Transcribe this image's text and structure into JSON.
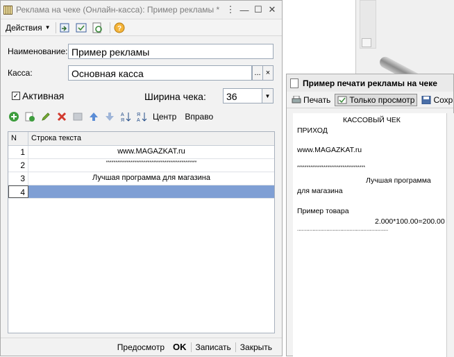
{
  "main_window": {
    "title": "Реклама на чеке (Онлайн-касса): Пример рекламы *",
    "toolbar": {
      "actions_label": "Действия"
    },
    "form": {
      "name_label": "Наименование:",
      "name_value": "Пример рекламы",
      "kassa_label": "Касса:",
      "kassa_value": "Основная касса",
      "kassa_select_btn": "...",
      "kassa_clear_btn": "×",
      "active_label": "Активная",
      "active_checked": true,
      "width_label": "Ширина чека:",
      "width_value": "36"
    },
    "cmdbar": {
      "center_label": "Центр",
      "right_label": "Вправо"
    },
    "grid": {
      "col_n": "N",
      "col_text": "Строка текста",
      "rows": [
        {
          "n": "1",
          "text": "www.MAGAZKAT.ru"
        },
        {
          "n": "2",
          "text": "************************************************"
        },
        {
          "n": "3",
          "text": "Лучшая программа для магазина"
        },
        {
          "n": "4",
          "text": ""
        }
      ]
    },
    "bottom": {
      "preview": "Предосмотр",
      "ok": "OK",
      "save": "Записать",
      "close": "Закрыть"
    }
  },
  "preview_window": {
    "title": "Пример печати рекламы на чеке",
    "tools": {
      "print": "Печать",
      "readonly": "Только просмотр",
      "save": "Сохран"
    },
    "lines": [
      "КАССОВЫЙ ЧЕК",
      "ПРИХОД",
      "www.MAGAZKAT.ru",
      "************************************",
      "Лучшая программа",
      "для магазина",
      "Пример товара",
      "2.000*100.00=200.00",
      "..........................................................."
    ]
  }
}
